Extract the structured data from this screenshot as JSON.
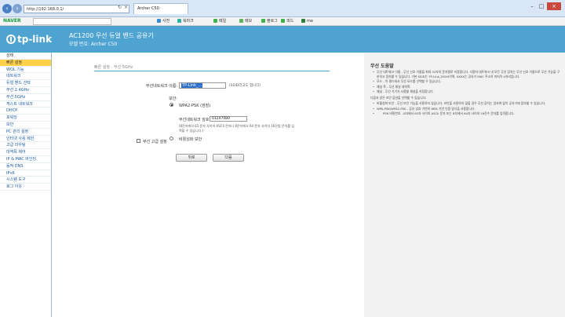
{
  "browser": {
    "address": "http://192.168.0.1/",
    "tabs": [
      {
        "label": "Archer C50"
      }
    ],
    "toolbar": {
      "brand": "NAVER",
      "items": [
        "사전",
        "북마크",
        "메일",
        "메모",
        "블로그",
        "피드",
        "me"
      ]
    }
  },
  "router": {
    "brand": "tp-link",
    "product_title": "AC1200 무선 듀얼 밴드 공유기",
    "model_label": "모델 번호: Archer C50"
  },
  "sidebar": {
    "items": [
      {
        "label": "상태"
      },
      {
        "label": "빠른 설정"
      },
      {
        "label": "WOL 기능"
      },
      {
        "label": "네트워크"
      },
      {
        "label": "듀얼 밴드 선택"
      },
      {
        "label": "무선 2.4GHz"
      },
      {
        "label": "무선 5GHz"
      },
      {
        "label": "게스트 네트워크"
      },
      {
        "label": "DHCP"
      },
      {
        "label": "포워딩"
      },
      {
        "label": "보안"
      },
      {
        "label": "PC 관리 설정"
      },
      {
        "label": "인터넷 사용 제한"
      },
      {
        "label": "고급 라우팅"
      },
      {
        "label": "대역폭 제어"
      },
      {
        "label": "IP & MAC 바인딩"
      },
      {
        "label": "동적 DNS"
      },
      {
        "label": "IPv6"
      },
      {
        "label": "시스템 도구"
      },
      {
        "label": "로그 아웃"
      }
    ]
  },
  "form": {
    "section_title": "빠른 설정 - 무선 5GHz",
    "ssid_label": "무선네트워크 이름:",
    "ssid_value": "TP-Link_...",
    "ssid_hint": "(SSID라고도 합니다)",
    "security_label": "보안:",
    "security_wpa2_label": "WPA2-PSK (권장)",
    "password_label": "무선네트워크 암호:",
    "password_value": "01247080",
    "password_note": "(8문자에서 63 문자 사이의 ASCII 문자나 8문자에서 64 문자 사이의 16진법 문자를 입력할 수 있습니다.)",
    "security_none_label": "비활성화 보안",
    "advanced_label": "무선 고급 설정",
    "back_button": "뒤로",
    "next_button": "다음"
  },
  "help": {
    "title": "무선 도움말",
    "bullets": [
      "무선 네트워크 이름 - 무선 신호 이름을 최대 32자의 문자열로 지정합니다. 사용자 네트워크 내 모든 무선 장치는 무선 신호 이름으로 무선 기능을 구분하고 접속할 수 있습니다. 기본 SSID는 TP-Link_XXXX이며, XXXX는 공유기 MAC 주소의 마지막 4자리입니다.",
      "모드 - 이 필드에서 무선 모드를 선택할 수 있습니다.",
      "채널 폭 - 무선 채널 대역폭.",
      "채널 - 무선 기기가 사용할 채널을 지정합니다."
    ],
    "middle_text": "다음과 같은 보안 옵션을 선택할 수 있습니다:",
    "security_bullets": [
      "비활성화 보안 - 무선 보안 기능을 사용하지 않습니다. 보안을 사용하지 않을 경우 무선 장치는 암호화 없이 공유기에 접속할 수 있습니다.",
      "WPA-PSK/WPA2-PSK - 공유 암호 기반의 WPA 기반 인증 방식을 사용합니다.",
      "PSK 비밀번호 - 8자에서 63자 사이의 ASCII 문자 또는 8자에서 64자 사이의 16진수 문자를 입력합니다."
    ]
  }
}
